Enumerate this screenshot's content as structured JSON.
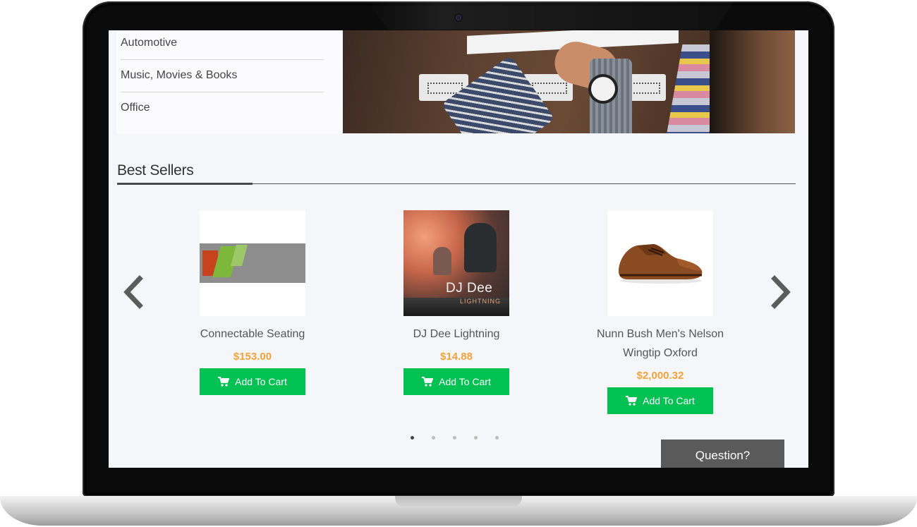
{
  "sidebar": {
    "categories": [
      {
        "label": "Automotive"
      },
      {
        "label": "Music, Movies & Books"
      },
      {
        "label": "Office"
      }
    ]
  },
  "best_sellers": {
    "title": "Best Sellers",
    "products": [
      {
        "name": "Connectable Seating",
        "price": "$153.00",
        "button": "Add To Cart"
      },
      {
        "name": "DJ Dee Lightning",
        "price": "$14.88",
        "button": "Add To Cart",
        "image_text": "DJ  Dee",
        "image_subtext": "LIGHTNING"
      },
      {
        "name_line1": "Nunn Bush Men's Nelson",
        "name_line2": "Wingtip Oxford",
        "price": "$2,000.32",
        "button": "Add To Cart"
      }
    ],
    "carousel_page": 1,
    "carousel_pages": 5
  },
  "question_button": "Question?",
  "colors": {
    "add_to_cart": "#00c152",
    "price": "#f2a23a",
    "question_button": "#5a5a5a"
  },
  "icons": [
    "chevron-left-icon",
    "chevron-right-icon",
    "cart-icon"
  ]
}
